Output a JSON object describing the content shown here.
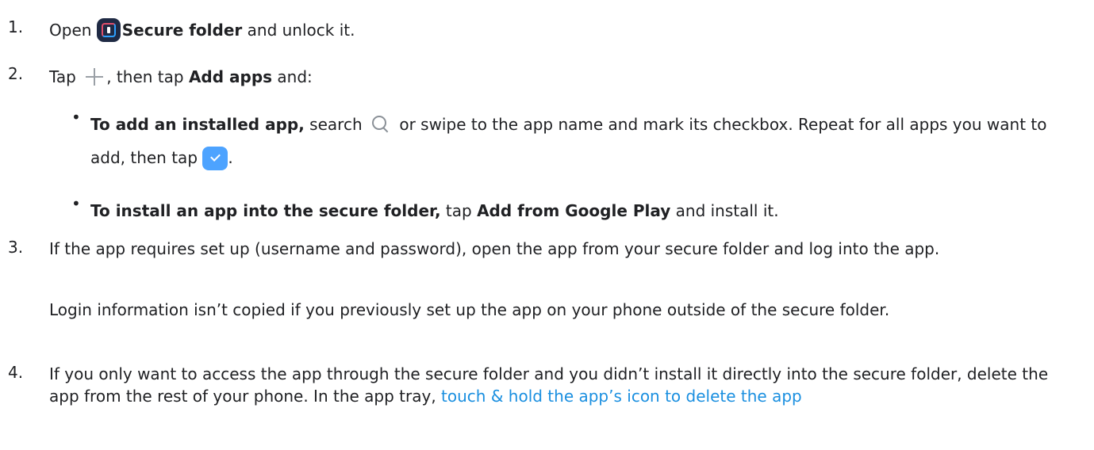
{
  "steps": [
    {
      "number": "1.",
      "parts": [
        "Open ",
        "Secure folder",
        " and unlock it."
      ]
    },
    {
      "number": "2.",
      "parts": [
        "Tap ",
        ", then tap ",
        "Add apps",
        " and:"
      ]
    },
    {
      "number": "3.",
      "text": "If the app requires set up (username and password), open the app from your secure folder and log into the app.",
      "note": "Login information isn’t copied if you previously set up the app on your phone outside of the secure folder."
    },
    {
      "number": "4.",
      "text": "If you only want to access the app through the secure folder and you didn’t install it directly into the secure folder, delete the app from the rest of your phone. In the app tray, ",
      "link": "touch & hold the app’s icon to delete the app"
    }
  ],
  "bullets": [
    {
      "lead": "To add an installed app,",
      "text1": " search ",
      "text2": " or swipe to the app name and mark its checkbox. Repeat for all apps you want to add, then tap ",
      "text3": "."
    },
    {
      "lead": "To install an app into the secure folder,",
      "text1": " tap ",
      "bold2": "Add from Google Play",
      "text2": " and install it."
    }
  ],
  "icons": {
    "folder": "secure-folder-icon",
    "plus": "plus-icon",
    "search": "search-icon",
    "check": "check-icon"
  },
  "colors": {
    "text": "#202124",
    "link": "#1a8fe0",
    "check": "#4da3ff",
    "folder": "#1f2a44"
  }
}
